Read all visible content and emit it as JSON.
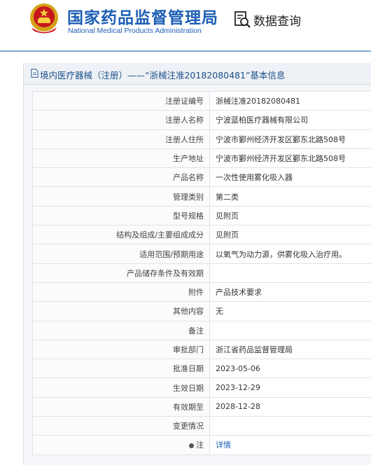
{
  "header": {
    "org_name_cn": "国家药品监督管理局",
    "org_name_en": "National Medical Products Administration",
    "query_label": "数据查询",
    "emblem_icon": "national-emblem-icon",
    "query_icon": "data-search-icon",
    "brand_color": "#1d5fb6"
  },
  "panel": {
    "title": "境内医疗器械（注册）——“浙械注准20182080481”基本信息",
    "title_icon": "document-icon"
  },
  "rows": [
    {
      "label": "注册证编号",
      "value": "浙械注准20182080481"
    },
    {
      "label": "注册人名称",
      "value": "宁波蓝柏医疗器械有限公司"
    },
    {
      "label": "注册人住所",
      "value": "宁波市鄞州经济开发区鄞东北路508号"
    },
    {
      "label": "生产地址",
      "value": "宁波市鄞州经济开发区鄞东北路508号"
    },
    {
      "label": "产品名称",
      "value": "一次性使用雾化吸入器"
    },
    {
      "label": "管理类别",
      "value": "第二类"
    },
    {
      "label": "型号规格",
      "value": "见附页"
    },
    {
      "label": "结构及组成/主要组成成分",
      "value": "见附页"
    },
    {
      "label": "适用范围/预期用途",
      "value": "以氧气为动力源，供雾化吸入治疗用。"
    },
    {
      "label": "产品储存条件及有效期",
      "value": ""
    },
    {
      "label": "附件",
      "value": "产品技术要求"
    },
    {
      "label": "其他内容",
      "value": "无"
    },
    {
      "label": "备注",
      "value": ""
    },
    {
      "label": "审批部门",
      "value": "浙江省药品监督管理局"
    },
    {
      "label": "批准日期",
      "value": "2023-05-06"
    },
    {
      "label": "生效日期",
      "value": "2023-12-29"
    },
    {
      "label": "有效期至",
      "value": "2028-12-28"
    },
    {
      "label": "变更情况",
      "value": ""
    }
  ],
  "note": {
    "label": "注",
    "link_text": "详情",
    "icon": "bullet-icon"
  }
}
